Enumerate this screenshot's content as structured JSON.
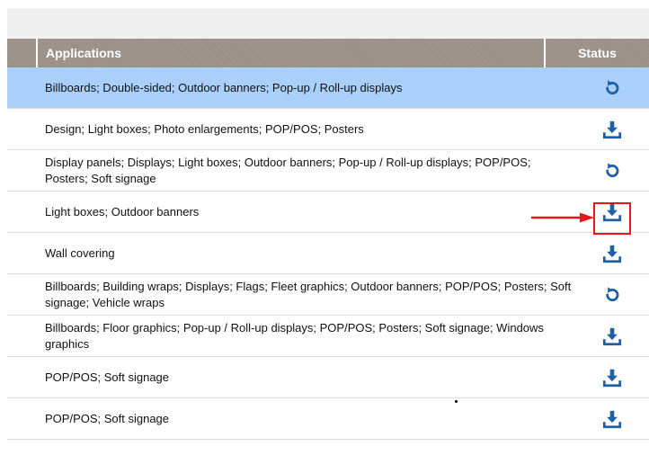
{
  "table": {
    "header": {
      "applications": "Applications",
      "status": "Status"
    },
    "rows": [
      {
        "applications": "Billboards; Double-sided; Outdoor banners; Pop-up / Roll-up displays",
        "status_icon": "refresh-icon"
      },
      {
        "applications": "Design; Light boxes; Photo enlargements; POP/POS; Posters",
        "status_icon": "download-icon"
      },
      {
        "applications": "Display panels; Displays; Light boxes; Outdoor banners; Pop-up / Roll-up displays; POP/POS; Posters; Soft signage",
        "status_icon": "refresh-icon"
      },
      {
        "applications": "Light boxes; Outdoor banners",
        "status_icon": "download-icon"
      },
      {
        "applications": "Wall covering",
        "status_icon": "download-icon"
      },
      {
        "applications": "Billboards; Building wraps; Displays; Flags; Fleet graphics; Outdoor banners; POP/POS; Posters; Soft signage; Vehicle wraps",
        "status_icon": "refresh-icon"
      },
      {
        "applications": "Billboards; Floor graphics; Pop-up / Roll-up displays; POP/POS; Posters; Soft signage; Windows graphics",
        "status_icon": "download-icon"
      },
      {
        "applications": "POP/POS; Soft signage",
        "status_icon": "download-icon"
      },
      {
        "applications": "POP/POS; Soft signage",
        "status_icon": "download-icon"
      }
    ]
  },
  "colors": {
    "header_bg": "#9a9087",
    "selected_row_bg": "#a9d0fb",
    "icon_blue": "#1f5fa6",
    "annotation_red": "#e8151d"
  },
  "annotation": {
    "arrow_icon": "red-arrow-icon",
    "highlight_box": "red-highlight-box"
  }
}
